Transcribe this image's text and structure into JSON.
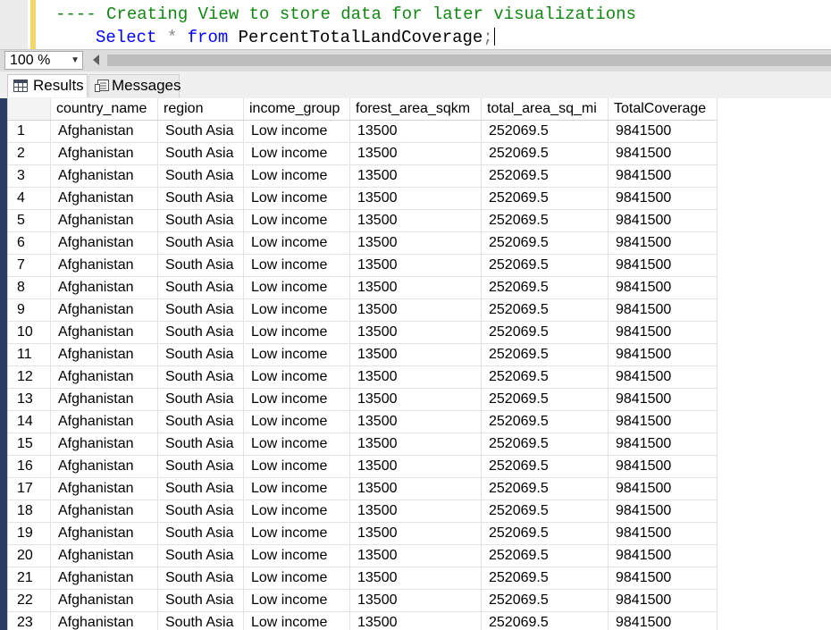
{
  "editor": {
    "line1_comment": "---- Creating View to store data for later visualizations",
    "line2": {
      "kw_select": "Select",
      "star": "*",
      "kw_from": "from",
      "table": "PercentTotalLandCoverage",
      "semicolon": ";"
    }
  },
  "zoom": {
    "value": "100 %"
  },
  "tabs": [
    {
      "label": "Results",
      "icon": "grid-icon",
      "active": true
    },
    {
      "label": "Messages",
      "icon": "messages-icon",
      "active": false
    }
  ],
  "grid": {
    "columns": [
      "",
      "country_name",
      "region",
      "income_group",
      "forest_area_sqkm",
      "total_area_sq_mi",
      "TotalCoverage"
    ],
    "rows": [
      [
        "1",
        "Afghanistan",
        "South Asia",
        "Low income",
        "13500",
        "252069.5",
        "9841500"
      ],
      [
        "2",
        "Afghanistan",
        "South Asia",
        "Low income",
        "13500",
        "252069.5",
        "9841500"
      ],
      [
        "3",
        "Afghanistan",
        "South Asia",
        "Low income",
        "13500",
        "252069.5",
        "9841500"
      ],
      [
        "4",
        "Afghanistan",
        "South Asia",
        "Low income",
        "13500",
        "252069.5",
        "9841500"
      ],
      [
        "5",
        "Afghanistan",
        "South Asia",
        "Low income",
        "13500",
        "252069.5",
        "9841500"
      ],
      [
        "6",
        "Afghanistan",
        "South Asia",
        "Low income",
        "13500",
        "252069.5",
        "9841500"
      ],
      [
        "7",
        "Afghanistan",
        "South Asia",
        "Low income",
        "13500",
        "252069.5",
        "9841500"
      ],
      [
        "8",
        "Afghanistan",
        "South Asia",
        "Low income",
        "13500",
        "252069.5",
        "9841500"
      ],
      [
        "9",
        "Afghanistan",
        "South Asia",
        "Low income",
        "13500",
        "252069.5",
        "9841500"
      ],
      [
        "10",
        "Afghanistan",
        "South Asia",
        "Low income",
        "13500",
        "252069.5",
        "9841500"
      ],
      [
        "11",
        "Afghanistan",
        "South Asia",
        "Low income",
        "13500",
        "252069.5",
        "9841500"
      ],
      [
        "12",
        "Afghanistan",
        "South Asia",
        "Low income",
        "13500",
        "252069.5",
        "9841500"
      ],
      [
        "13",
        "Afghanistan",
        "South Asia",
        "Low income",
        "13500",
        "252069.5",
        "9841500"
      ],
      [
        "14",
        "Afghanistan",
        "South Asia",
        "Low income",
        "13500",
        "252069.5",
        "9841500"
      ],
      [
        "15",
        "Afghanistan",
        "South Asia",
        "Low income",
        "13500",
        "252069.5",
        "9841500"
      ],
      [
        "16",
        "Afghanistan",
        "South Asia",
        "Low income",
        "13500",
        "252069.5",
        "9841500"
      ],
      [
        "17",
        "Afghanistan",
        "South Asia",
        "Low income",
        "13500",
        "252069.5",
        "9841500"
      ],
      [
        "18",
        "Afghanistan",
        "South Asia",
        "Low income",
        "13500",
        "252069.5",
        "9841500"
      ],
      [
        "19",
        "Afghanistan",
        "South Asia",
        "Low income",
        "13500",
        "252069.5",
        "9841500"
      ],
      [
        "20",
        "Afghanistan",
        "South Asia",
        "Low income",
        "13500",
        "252069.5",
        "9841500"
      ],
      [
        "21",
        "Afghanistan",
        "South Asia",
        "Low income",
        "13500",
        "252069.5",
        "9841500"
      ],
      [
        "22",
        "Afghanistan",
        "South Asia",
        "Low income",
        "13500",
        "252069.5",
        "9841500"
      ],
      [
        "23",
        "Afghanistan",
        "South Asia",
        "Low income",
        "13500",
        "252069.5",
        "9841500"
      ]
    ]
  }
}
